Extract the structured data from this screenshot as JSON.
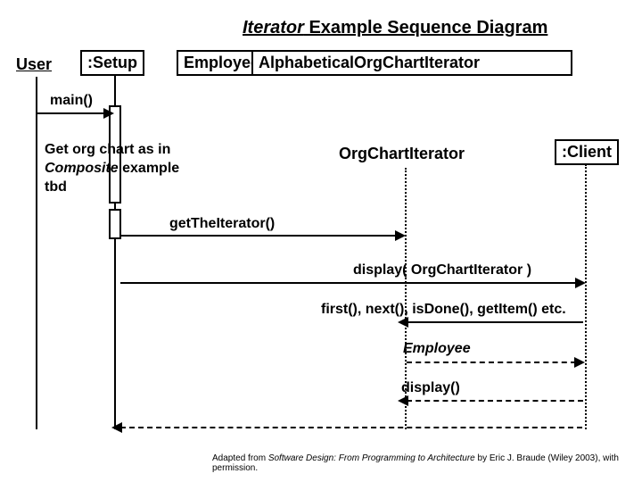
{
  "title_italic": "Iterator",
  "title_rest": " Example Sequence Diagram",
  "actor_user": "User",
  "p_setup": ":Setup",
  "p_employee": "Employee",
  "p_alpha": "AlphabeticalOrgChartIterator",
  "p_orgchart": "OrgChartIterator",
  "p_client": ":Client",
  "msg_main": "main()",
  "note_l1": "Get org chart as in",
  "note_l2_italic": "Composite",
  "note_l2_rest": " example",
  "note_l3": "tbd",
  "msg_getiter": "getTheIterator()",
  "msg_display1": "display( OrgChartIterator )",
  "msg_methods": "first(), next(), isDone(), getItem() etc.",
  "msg_employee_ret": "Employee",
  "msg_display2": "display()",
  "footer_pre": "Adapted from ",
  "footer_ital": "Software Design: From Programming to Architecture",
  "footer_post": " by Eric J. Braude (Wiley 2003), with permission."
}
